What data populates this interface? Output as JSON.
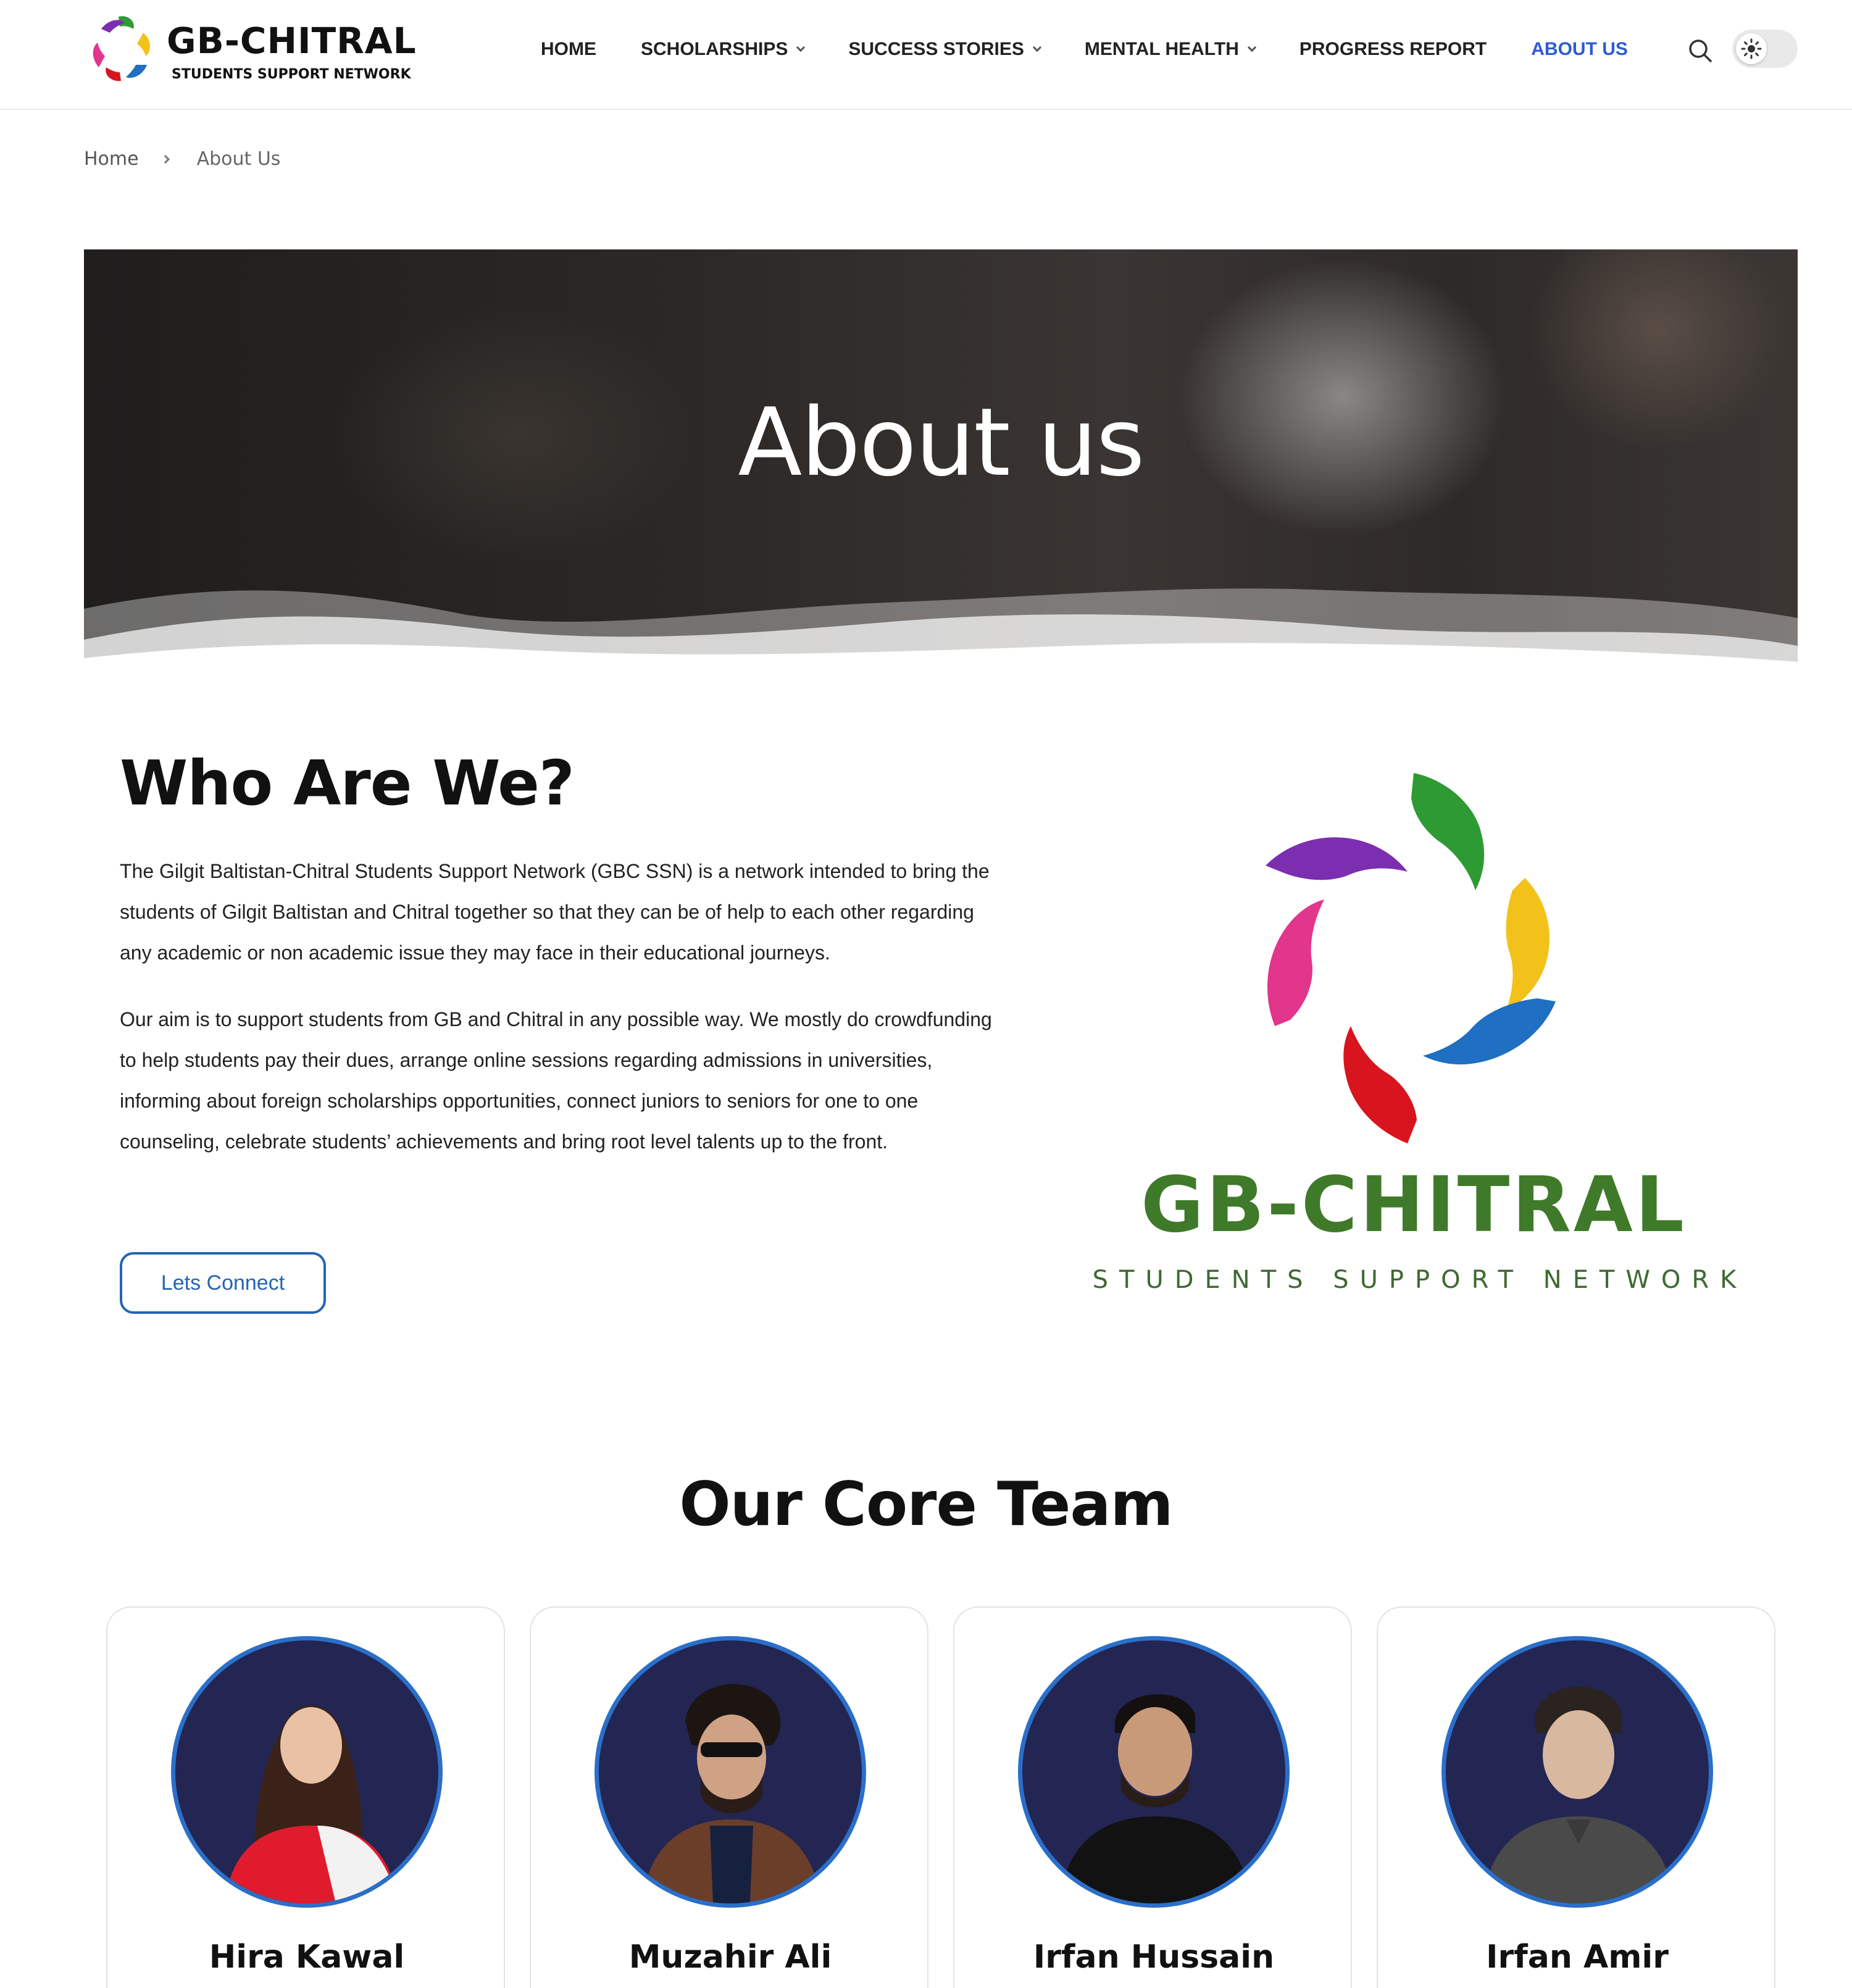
{
  "header": {
    "logo_title": "GB-CHITRAL",
    "logo_subtitle": "STUDENTS SUPPORT NETWORK",
    "nav": [
      {
        "label": "HOME",
        "dropdown": false,
        "active": false
      },
      {
        "label": "SCHOLARSHIPS",
        "dropdown": true,
        "active": false
      },
      {
        "label": "SUCCESS STORIES",
        "dropdown": true,
        "active": false
      },
      {
        "label": "MENTAL HEALTH",
        "dropdown": true,
        "active": false
      },
      {
        "label": "PROGRESS REPORT",
        "dropdown": false,
        "active": false
      },
      {
        "label": "ABOUT US",
        "dropdown": false,
        "active": true
      }
    ],
    "search_icon": "search-icon",
    "theme_toggle_icon": "sun-icon",
    "active_color": "#2f5bd0"
  },
  "breadcrumb": {
    "home": "Home",
    "current": "About Us"
  },
  "hero": {
    "title": "About us"
  },
  "who": {
    "title": "Who Are We?",
    "paragraph_1": "The Gilgit Baltistan-Chitral Students Support Network (GBC SSN) is a network intended to bring the students of Gilgit Baltistan and Chitral together so that they can be of help to each other regarding any academic or non academic issue they may face in their educational journeys.",
    "paragraph_2": "Our aim is to support students from GB and Chitral in any possible way. We mostly do crowdfunding to help students pay their dues, arrange online sessions regarding admissions in universities, informing about foreign scholarships opportunities, connect juniors to seniors for one to one counseling, celebrate students’ achievements and bring root level talents up to the front.",
    "button_label": "Lets Connect",
    "logo_title": "GB-CHITRAL",
    "logo_subtitle": "STUDENTS SUPPORT NETWORK",
    "button_color": "#2464b4"
  },
  "team": {
    "title": "Our Core Team",
    "members": [
      {
        "name": "Hira Kawal"
      },
      {
        "name": "Muzahir Ali"
      },
      {
        "name": "Irfan Hussain"
      },
      {
        "name": "Irfan Amir"
      }
    ]
  },
  "colors": {
    "hand_purple": "#7b2fb0",
    "hand_green": "#2e9a33",
    "hand_yellow": "#f2c21a",
    "hand_blue": "#1f6fc2",
    "hand_red": "#d8141e",
    "hand_pink": "#e2358c",
    "logo_green": "#3f7a2a"
  }
}
